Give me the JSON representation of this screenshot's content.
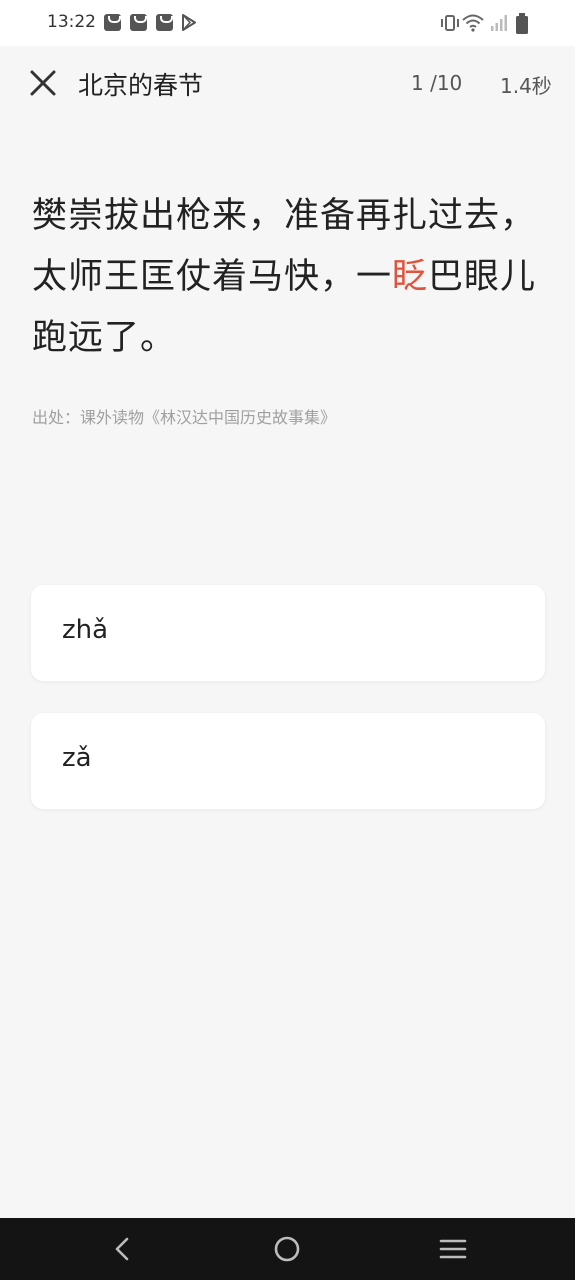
{
  "status_bar": {
    "time": "13:22",
    "notification_icons": [
      "shopping-bag-icon",
      "shopping-bag-icon",
      "shopping-bag-icon",
      "play-store-icon"
    ],
    "system_icons": [
      "vibrate-icon",
      "wifi-icon",
      "signal-icon",
      "battery-icon"
    ]
  },
  "header": {
    "title": "北京的春节",
    "progress": "1 /10",
    "timer": "1.4秒"
  },
  "passage": {
    "before": "樊崇拔出枪来，准备再扎过去，太师王匡仗着马快，一",
    "highlight": "眨",
    "after": "巴眼儿跑远了。",
    "highlight_color": "#e0533c",
    "source": "出处：课外读物《林汉达中国历史故事集》"
  },
  "options": [
    {
      "text": "zhǎ"
    },
    {
      "text": "zǎ"
    }
  ],
  "nav_bar": {
    "buttons": [
      "back-icon",
      "home-icon",
      "menu-icon"
    ]
  }
}
